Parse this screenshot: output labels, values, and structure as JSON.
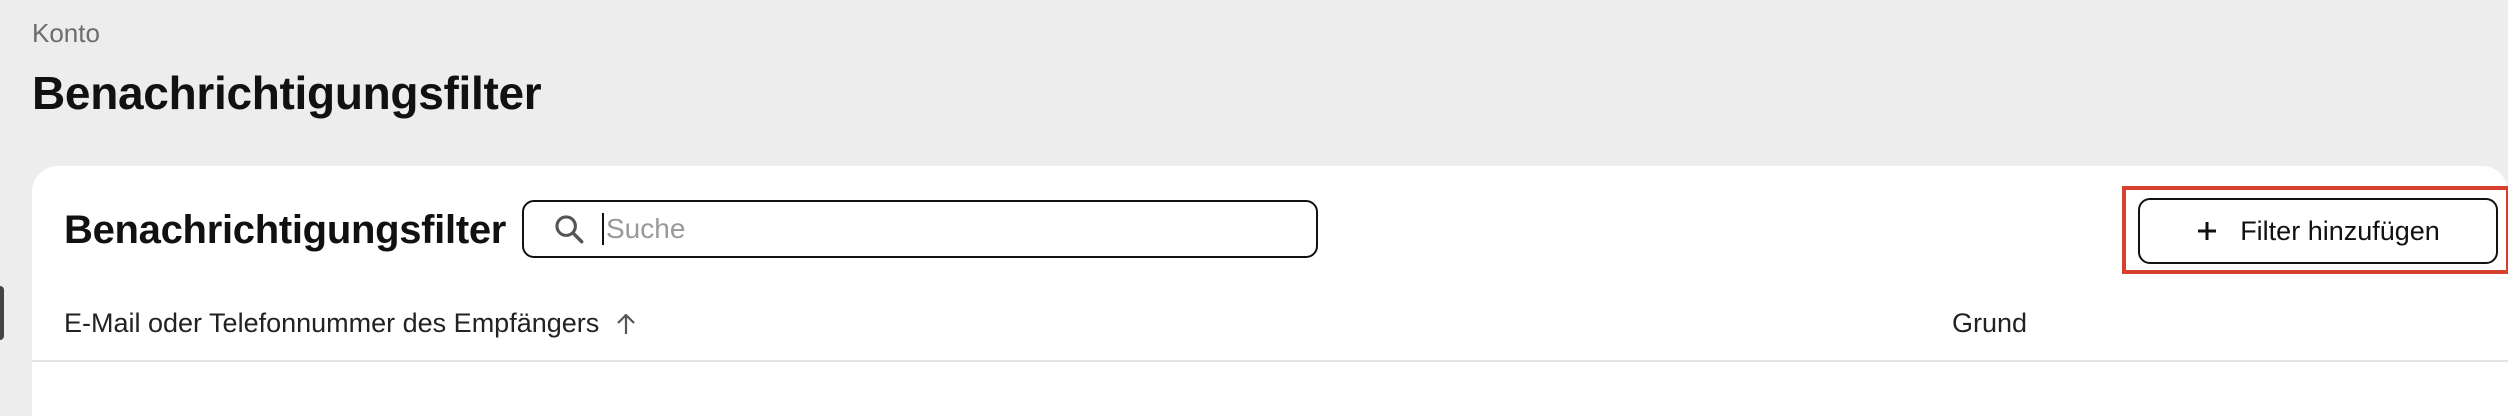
{
  "breadcrumb": "Konto",
  "page_title": "Benachrichtigungsfilter",
  "card": {
    "title": "Benachrichtigungsfilter",
    "search": {
      "placeholder": "Suche",
      "value": "",
      "icon": "search-icon"
    },
    "add_button": {
      "label": "Filter hinzufügen",
      "icon": "plus-icon"
    },
    "highlight_color": "#d6402c"
  },
  "table": {
    "columns": [
      {
        "label": "E-Mail oder Telefonnummer des Empfängers",
        "sort": "ascending",
        "icon": "arrow-up-icon"
      },
      {
        "label": "Grund"
      }
    ],
    "rows": []
  }
}
